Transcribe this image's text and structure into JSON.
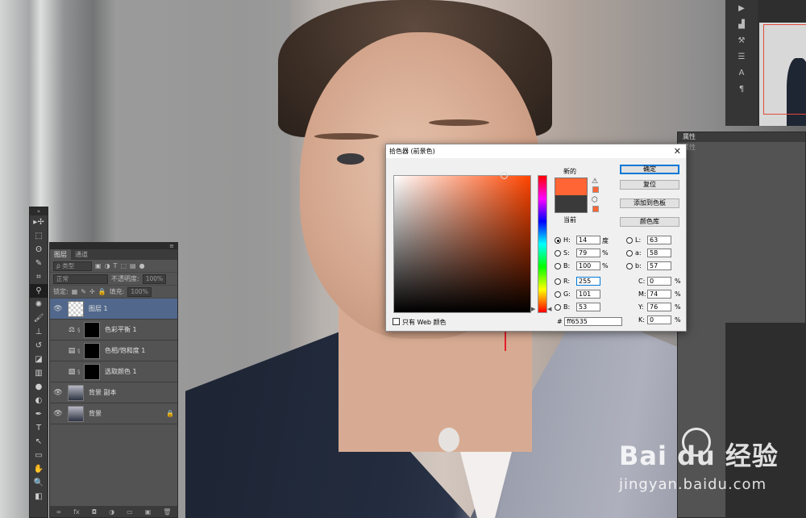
{
  "colors": {
    "new": "#ff6535",
    "current": "#3a3a3a",
    "hue_cursor": "#ff4500",
    "arrow": "#e5202a",
    "selection": "#51688c"
  },
  "toolbar": {
    "grip": "»",
    "tools": [
      "move-icon",
      "marquee-icon",
      "lasso-icon",
      "quick-select-icon",
      "crop-icon",
      "eyedropper-icon",
      "spot-heal-icon",
      "brush-icon",
      "stamp-icon",
      "history-brush-icon",
      "eraser-icon",
      "gradient-icon",
      "blur-icon",
      "dodge-icon",
      "pen-icon",
      "type-icon",
      "path-select-icon",
      "shape-icon",
      "hand-icon",
      "zoom-icon",
      "default-colors-icon"
    ],
    "glyphs": [
      "▸✢",
      "⬚",
      "ʘ",
      "✎",
      "⌗",
      "⚲",
      "✺",
      "🖌",
      "⊥",
      "↺",
      "◪",
      "▥",
      "●",
      "◐",
      "✒",
      "T",
      "↖",
      "▭",
      "✋",
      "🔍",
      "◧"
    ]
  },
  "layers": {
    "tabs": [
      "图层",
      "通道"
    ],
    "filter_label": "ρ 类型",
    "blend_mode": "正常",
    "opacity_label": "不透明度:",
    "opacity_value": "100%",
    "lock_label": "锁定:",
    "fill_label": "填充:",
    "fill_value": "100%",
    "items": [
      {
        "name": "图层 1",
        "eye": "👁",
        "selected": true
      },
      {
        "name": "色彩平衡 1",
        "eye": "",
        "adj": "⚖"
      },
      {
        "name": "色相/饱和度 1",
        "eye": "",
        "adj": "▤"
      },
      {
        "name": "选取颜色 1",
        "eye": "",
        "adj": "▧"
      },
      {
        "name": "背景 副本",
        "eye": "👁"
      },
      {
        "name": "背景",
        "eye": "👁",
        "lock": "🔒"
      }
    ],
    "bottom_icons": [
      "∞",
      "fx",
      "◘",
      "◑",
      "▭",
      "▣",
      "🗑"
    ]
  },
  "properties": {
    "title": "属性",
    "subtitle": "属性"
  },
  "picker": {
    "title": "拾色器 (前景色)",
    "close": "✕",
    "new_label": "新的",
    "current_label": "当前",
    "buttons": {
      "ok": "确定",
      "reset": "复位",
      "add_swatch": "添加到色板",
      "libraries": "颜色库"
    },
    "hsb": {
      "H": "14",
      "S": "79",
      "B": "100"
    },
    "rgb": {
      "R": "255",
      "G": "101",
      "B": "53"
    },
    "lab": {
      "L": "63",
      "a": "58",
      "b": "57"
    },
    "cmyk": {
      "C": "0",
      "M": "74",
      "Y": "76",
      "K": "0"
    },
    "units": {
      "deg": "度",
      "pct": "%"
    },
    "hex_label": "#",
    "hex": "ff6535",
    "web_only": "只有 Web 颜色"
  },
  "watermark": {
    "brand": "Bai  du 经验",
    "url": "jingyan.baidu.com"
  }
}
